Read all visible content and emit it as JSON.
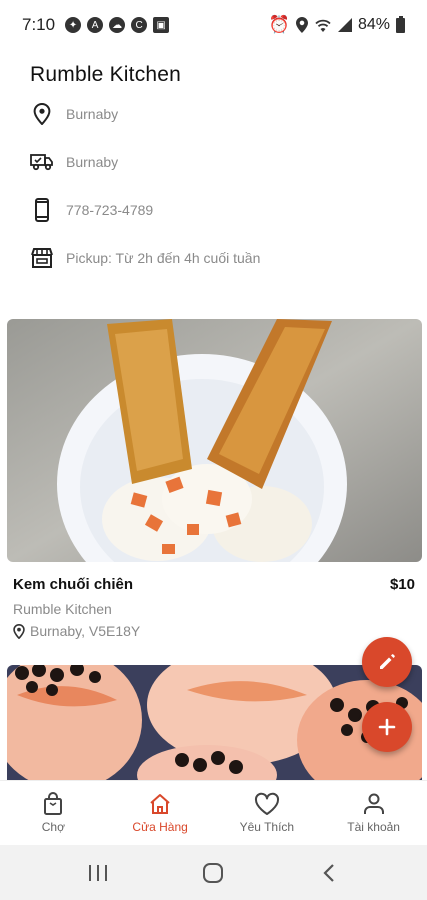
{
  "status_bar": {
    "time": "7:10",
    "battery": "84%"
  },
  "store": {
    "name": "Rumble Kitchen",
    "address": "Burnaby",
    "delivery": "Burnaby",
    "phone": "778-723-4789",
    "pickup": "Pickup: Từ 2h đến 4h cuối tuần"
  },
  "products": [
    {
      "name": "Kem chuối chiên",
      "price": "$10",
      "store": "Rumble Kitchen",
      "location": "Burnaby, V5E18Y"
    }
  ],
  "bottom_nav": {
    "items": [
      {
        "label": "Chợ",
        "icon": "bag-icon"
      },
      {
        "label": "Cửa Hàng",
        "icon": "store-icon"
      },
      {
        "label": "Yêu Thích",
        "icon": "heart-icon"
      },
      {
        "label": "Tài khoản",
        "icon": "user-icon"
      }
    ],
    "active_index": 1
  },
  "colors": {
    "accent": "#d9482b",
    "muted_text": "#8a8a8a"
  }
}
